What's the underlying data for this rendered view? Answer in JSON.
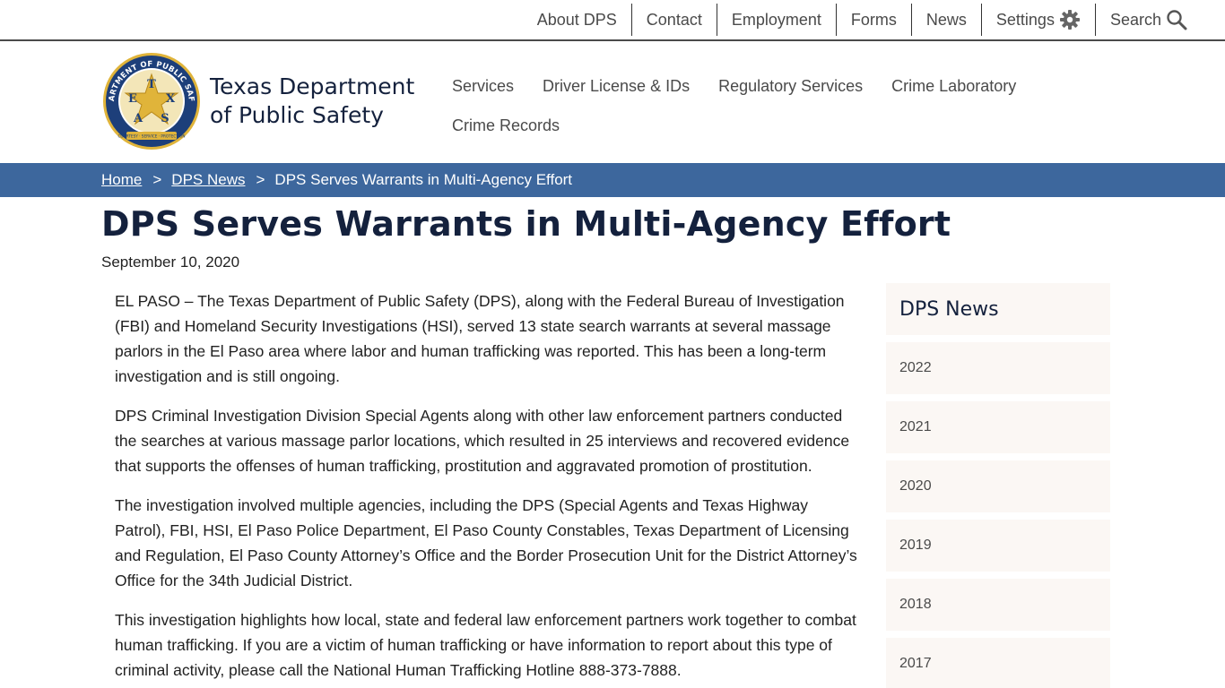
{
  "utility_nav": {
    "items": [
      "About DPS",
      "Contact",
      "Employment",
      "Forms",
      "News"
    ],
    "settings_label": "Settings",
    "search_label": "Search"
  },
  "header": {
    "agency_name": "Texas Department of Public Safety",
    "seal": {
      "top_text": "DEPARTMENT OF PUBLIC SAFETY",
      "letters": [
        "T",
        "E",
        "X",
        "A",
        "S"
      ],
      "motto": "COURTESY · SERVICE · PROTECTION"
    },
    "main_nav": [
      "Services",
      "Driver License & IDs",
      "Regulatory Services",
      "Crime Laboratory",
      "Crime Records"
    ]
  },
  "breadcrumb": {
    "home": "Home",
    "section": "DPS News",
    "current": "DPS Serves Warrants in Multi-Agency Effort",
    "separator": ">"
  },
  "article": {
    "title": "DPS Serves Warrants in Multi-Agency Effort",
    "date": "September 10, 2020",
    "paragraphs": [
      "EL PASO – The Texas Department of Public Safety (DPS), along with the Federal Bureau of Investigation (FBI) and Homeland Security Investigations (HSI), served 13 state search warrants at several massage parlors in the El Paso area where labor and human trafficking was reported. This has been a long-term investigation and is still ongoing.",
      "DPS Criminal Investigation Division Special Agents along with other law enforcement partners conducted the searches at various massage parlor locations, which resulted in 25 interviews and recovered evidence that supports the offenses of human trafficking, prostitution and aggravated promotion of prostitution.",
      "The investigation involved multiple agencies, including the DPS (Special Agents and Texas Highway Patrol), FBI, HSI, El Paso Police Department, El Paso County Constables, Texas Department of Licensing and Regulation, El Paso County Attorney’s Office and the Border Prosecution Unit for the District Attorney’s Office for the 34th Judicial District.",
      "This investigation highlights how local, state and federal law enforcement partners work together to combat human trafficking. If you are a victim of human trafficking or have information to report about this type of criminal activity, please call the National Human Trafficking Hotline 888-373-7888."
    ]
  },
  "sidebar": {
    "heading": "DPS News",
    "years": [
      "2022",
      "2021",
      "2020",
      "2019",
      "2018",
      "2017"
    ]
  },
  "colors": {
    "breadcrumb_bg": "#3d679d",
    "title": "#14213d",
    "sidebar_bg": "#fbf7f4",
    "seal_blue": "#1d3f7a",
    "seal_gold": "#e0b43a"
  },
  "icons": {
    "settings": "gear-icon",
    "search": "search-icon"
  }
}
